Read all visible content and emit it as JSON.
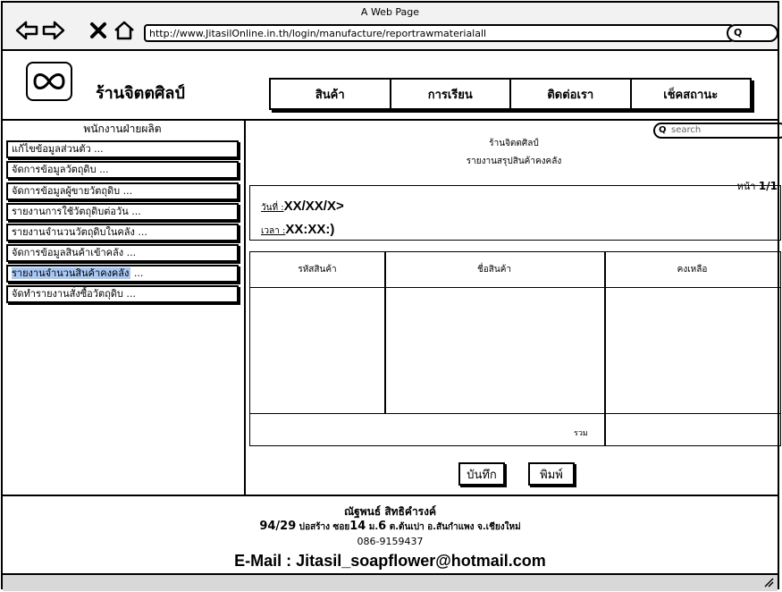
{
  "browser": {
    "window_title": "A Web Page",
    "url": "http://www.JitasilOnline.in.th/login/manufacture/reportrawmaterialall"
  },
  "brand": {
    "name": "ร้านจิตตศิลป์"
  },
  "nav": {
    "items": [
      {
        "label": "สินค้า"
      },
      {
        "label": "การเรียน"
      },
      {
        "label": "ติดต่อเรา"
      },
      {
        "label": "เช็คสถานะ"
      }
    ]
  },
  "sidebar": {
    "title": "พนักงานฝ่ายผลิต",
    "items": [
      {
        "label": "แก้ไขข้อมูลส่วนตัว",
        "more": "..."
      },
      {
        "label": "จัดการข้อมูลวัตถุดิบ",
        "more": "..."
      },
      {
        "label": "จัดการข้อมูลผู้ขายวัตถุดิบ",
        "more": "..."
      },
      {
        "label": "รายงานการใช้วัตถุดิบต่อวัน",
        "more": "..."
      },
      {
        "label": "รายงานจำนวนวัตถุดิบในคลัง",
        "more": "..."
      },
      {
        "label": "จัดการข้อมูลสินค้าเข้าคลัง",
        "more": "..."
      },
      {
        "label": "รายงานจำนวนสินค้าคงคลัง",
        "more": "...",
        "selected": true
      },
      {
        "label": "จัดทำรายงานสั่งซื้อวัตถุดิบ",
        "more": "..."
      }
    ],
    "selected_color": "#a8c8f5"
  },
  "report": {
    "search_placeholder": "search",
    "shop_name": "ร้านจิตตศิลป์",
    "title": "รายงานสรุปสินค้าคงคลัง",
    "page_label": "หน้า",
    "page_value": "1/1",
    "date_label": "วันที่ :",
    "date_value": "XX/XX/X>",
    "time_label": "เวลา :",
    "time_value": "XX:XX:)",
    "columns": [
      "รหัสสินค้า",
      "ชื่อสินค้า",
      "คงเหลือ"
    ],
    "total_label": "รวม",
    "save_label": "บันทึก",
    "print_label": "พิมพ์"
  },
  "footer": {
    "name": "ณัฐพนธ์ สิทธิคำรงค์",
    "address_parts": [
      "94/29",
      " บ่อสร้าง ซอย",
      "14",
      "  ม.",
      "6",
      " ต.ต้นเปา อ.สันกำแพง จ.เชียงใหม่"
    ],
    "phone": "086-9159437",
    "email": "E-Mail : Jitasil_soapflower@hotmail.com"
  },
  "icons": [
    "back-arrow-icon",
    "forward-arrow-icon",
    "close-icon",
    "home-icon",
    "search-icon",
    "infinity-logo-icon",
    "resize-grip-icon"
  ]
}
